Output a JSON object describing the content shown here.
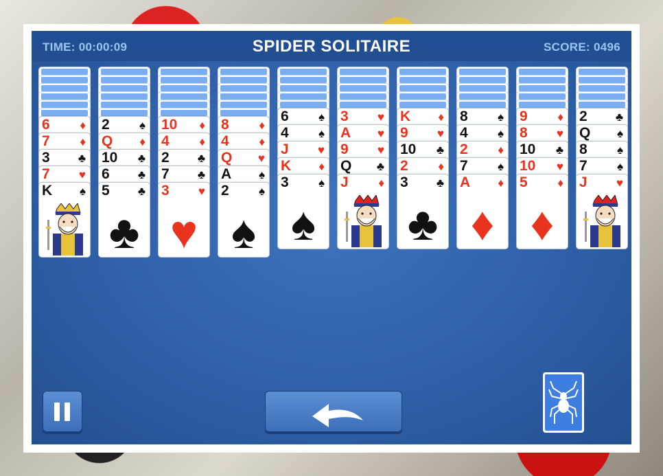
{
  "header": {
    "time_label": "TIME: 00:00:09",
    "title": "SPIDER SOLITAIRE",
    "score_label": "SCORE: 0496"
  },
  "colors": {
    "board": "#2f60a8",
    "header_text": "#9cc4f0",
    "card_back": "#7aaef0",
    "red_suit": "#e8331e"
  },
  "tableau": [
    {
      "hidden": 6,
      "cards": [
        {
          "rank": "6",
          "suit": "♦",
          "color": "red"
        },
        {
          "rank": "7",
          "suit": "♦",
          "color": "red"
        },
        {
          "rank": "3",
          "suit": "♣",
          "color": "black"
        },
        {
          "rank": "7",
          "suit": "♥",
          "color": "red"
        },
        {
          "rank": "K",
          "suit": "♠",
          "color": "black",
          "face": "king"
        }
      ]
    },
    {
      "hidden": 6,
      "cards": [
        {
          "rank": "2",
          "suit": "♠",
          "color": "black"
        },
        {
          "rank": "Q",
          "suit": "♦",
          "color": "red"
        },
        {
          "rank": "10",
          "suit": "♣",
          "color": "black"
        },
        {
          "rank": "6",
          "suit": "♣",
          "color": "black"
        },
        {
          "rank": "5",
          "suit": "♣",
          "color": "black"
        }
      ]
    },
    {
      "hidden": 6,
      "cards": [
        {
          "rank": "10",
          "suit": "♦",
          "color": "red"
        },
        {
          "rank": "4",
          "suit": "♦",
          "color": "red"
        },
        {
          "rank": "2",
          "suit": "♣",
          "color": "black"
        },
        {
          "rank": "7",
          "suit": "♣",
          "color": "black"
        },
        {
          "rank": "3",
          "suit": "♥",
          "color": "red"
        }
      ]
    },
    {
      "hidden": 6,
      "cards": [
        {
          "rank": "8",
          "suit": "♦",
          "color": "red"
        },
        {
          "rank": "4",
          "suit": "♦",
          "color": "red"
        },
        {
          "rank": "Q",
          "suit": "♥",
          "color": "red"
        },
        {
          "rank": "A",
          "suit": "♠",
          "color": "black"
        },
        {
          "rank": "2",
          "suit": "♠",
          "color": "black"
        }
      ]
    },
    {
      "hidden": 5,
      "cards": [
        {
          "rank": "6",
          "suit": "♠",
          "color": "black"
        },
        {
          "rank": "4",
          "suit": "♠",
          "color": "black"
        },
        {
          "rank": "J",
          "suit": "♥",
          "color": "red"
        },
        {
          "rank": "K",
          "suit": "♦",
          "color": "red"
        },
        {
          "rank": "3",
          "suit": "♠",
          "color": "black"
        }
      ]
    },
    {
      "hidden": 5,
      "cards": [
        {
          "rank": "3",
          "suit": "♥",
          "color": "red"
        },
        {
          "rank": "A",
          "suit": "♥",
          "color": "red"
        },
        {
          "rank": "9",
          "suit": "♥",
          "color": "red"
        },
        {
          "rank": "Q",
          "suit": "♣",
          "color": "black"
        },
        {
          "rank": "J",
          "suit": "♦",
          "color": "red",
          "face": "jack"
        }
      ]
    },
    {
      "hidden": 5,
      "cards": [
        {
          "rank": "K",
          "suit": "♦",
          "color": "red"
        },
        {
          "rank": "9",
          "suit": "♥",
          "color": "red"
        },
        {
          "rank": "10",
          "suit": "♣",
          "color": "black"
        },
        {
          "rank": "2",
          "suit": "♦",
          "color": "red"
        },
        {
          "rank": "3",
          "suit": "♣",
          "color": "black"
        }
      ]
    },
    {
      "hidden": 5,
      "cards": [
        {
          "rank": "8",
          "suit": "♠",
          "color": "black"
        },
        {
          "rank": "4",
          "suit": "♠",
          "color": "black"
        },
        {
          "rank": "2",
          "suit": "♦",
          "color": "red"
        },
        {
          "rank": "7",
          "suit": "♠",
          "color": "black"
        },
        {
          "rank": "A",
          "suit": "♦",
          "color": "red"
        }
      ]
    },
    {
      "hidden": 5,
      "cards": [
        {
          "rank": "9",
          "suit": "♦",
          "color": "red"
        },
        {
          "rank": "8",
          "suit": "♥",
          "color": "red"
        },
        {
          "rank": "10",
          "suit": "♣",
          "color": "black"
        },
        {
          "rank": "10",
          "suit": "♥",
          "color": "red"
        },
        {
          "rank": "5",
          "suit": "♦",
          "color": "red"
        }
      ]
    },
    {
      "hidden": 5,
      "cards": [
        {
          "rank": "2",
          "suit": "♣",
          "color": "black"
        },
        {
          "rank": "Q",
          "suit": "♠",
          "color": "black"
        },
        {
          "rank": "8",
          "suit": "♠",
          "color": "black"
        },
        {
          "rank": "7",
          "suit": "♠",
          "color": "black"
        },
        {
          "rank": "J",
          "suit": "♥",
          "color": "red",
          "face": "jack"
        }
      ]
    }
  ],
  "controls": {
    "pause_icon": "pause-icon",
    "undo_icon": "undo-arrow-icon",
    "stock_icon": "spider-icon"
  }
}
